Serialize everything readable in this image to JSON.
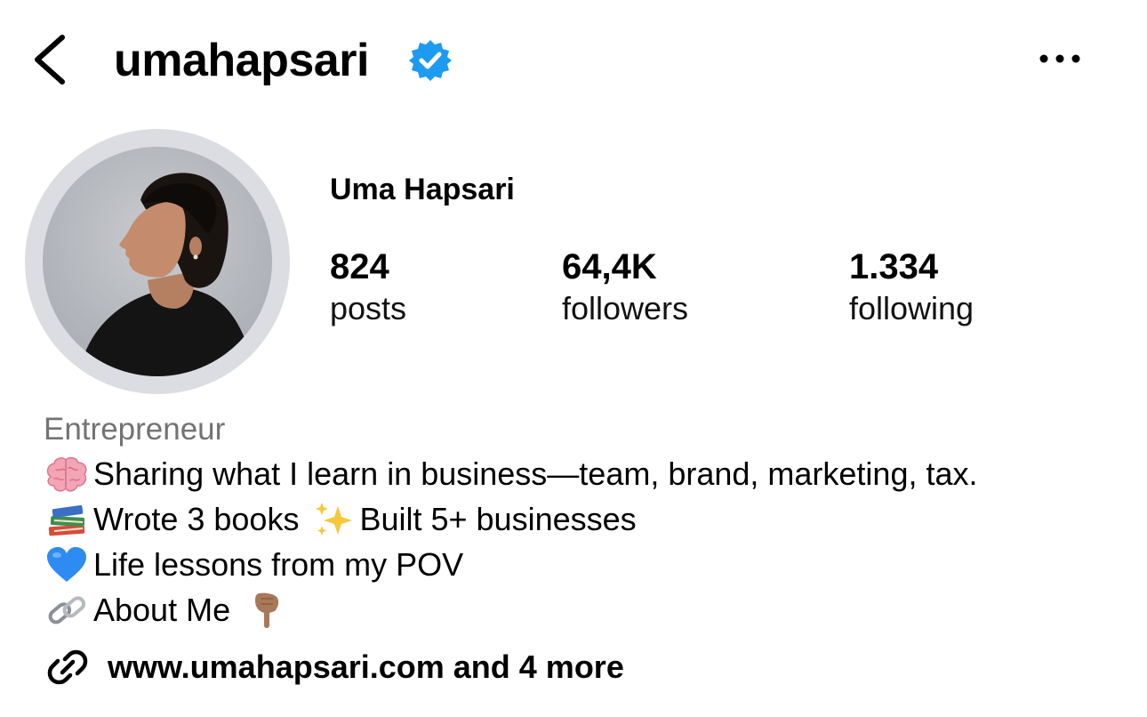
{
  "header": {
    "username": "umahapsari",
    "verified_icon": "verified-badge-icon",
    "back_icon": "chevron-left-icon",
    "more_icon": "more-horizontal-icon"
  },
  "profile": {
    "full_name": "Uma Hapsari",
    "stats": [
      {
        "value": "824",
        "label": "posts"
      },
      {
        "value": "64,4K",
        "label": "followers"
      },
      {
        "value": "1.334",
        "label": "following"
      }
    ]
  },
  "bio": {
    "category": "Entrepreneur",
    "lines": [
      {
        "icon": "brain-emoji",
        "text": "Sharing what I learn in business—team, brand, marketing, tax."
      },
      {
        "icon": "books-emoji",
        "text_before": "Wrote 3 books",
        "inline_icon": "sparkles-emoji",
        "text_after": "Built 5+ businesses"
      },
      {
        "icon": "blue-heart-emoji",
        "text": "Life lessons from my POV"
      },
      {
        "icon": "link-emoji",
        "text": "About Me",
        "trailing_icon": "pointing-down-emoji"
      }
    ]
  },
  "link": {
    "icon": "link-icon",
    "text": "www.umahapsari.com and 4 more"
  },
  "colors": {
    "verified": "#1d9bf0",
    "muted_text": "#737373",
    "ring": "#dcdde2"
  }
}
